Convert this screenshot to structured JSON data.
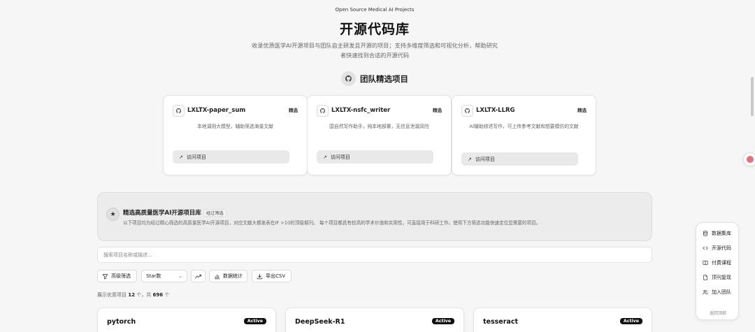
{
  "header": {
    "eyebrow": "Open Source Medical AI Projects",
    "title": "开源代码库",
    "subtitle": "收录优质医学AI开源项目与团队自主研发且开源的项目；支持多维度筛选和可视化分析，帮助研究者快速找到合适的开源代码"
  },
  "team_section": {
    "title": "团队精选项目",
    "visit_label": "访问项目",
    "tag_label": "精选",
    "projects": [
      {
        "name": "LXLTX-paper_sum",
        "desc": "本地调用大模型，辅助筛选海量文献",
        "icon": "github-icon"
      },
      {
        "name": "LXLTX-nsfc_writer",
        "desc": "国自然写作助手，纯本地部署，无信息泄漏风险",
        "icon": "github-icon"
      },
      {
        "name": "LXLTX-LLRG",
        "desc": "AI辅助综述写作，可上传参考文献和想要模仿的文献",
        "icon": "github-icon"
      }
    ]
  },
  "banner": {
    "title": "精选高质量医学AI开源项目库",
    "badge": "经过筛选",
    "desc": "以下项目均为经过精心筛选的高质量医学AI开源项目，对应文献大都发表在IF >10的顶级期刊。 每个项目都具有较高的学术价值和实用性，可直接用于科研工作。使用下方筛选功能快速定位您需要的项目。",
    "icon": "star-icon"
  },
  "search": {
    "placeholder": "搜索项目名称或描述..."
  },
  "toolbar": {
    "advanced_filter": "高级筛选",
    "sort_select": "Star数",
    "stats": "数据统计",
    "export": "导出CSV"
  },
  "results": {
    "prefix": "展示优质项目",
    "shown": "12",
    "middle": "个，共",
    "total": "696",
    "suffix": "个"
  },
  "project_cards": [
    {
      "name": "pytorch",
      "status": "Active"
    },
    {
      "name": "DeepSeek-R1",
      "status": "Active"
    },
    {
      "name": "tesseract",
      "status": "Active"
    }
  ],
  "sidenav": {
    "items": [
      {
        "label": "数据集库",
        "icon": "database-icon"
      },
      {
        "label": "开源代码",
        "icon": "code-icon"
      },
      {
        "label": "付费课程",
        "icon": "book-icon"
      },
      {
        "label": "顶刊复现",
        "icon": "document-icon"
      },
      {
        "label": "加入团队",
        "icon": "users-icon"
      }
    ],
    "back": "返回顶部"
  },
  "colors": {
    "background": "#f6f6f6",
    "badge_bg": "#111111",
    "floating_dot": "#e5707b"
  }
}
